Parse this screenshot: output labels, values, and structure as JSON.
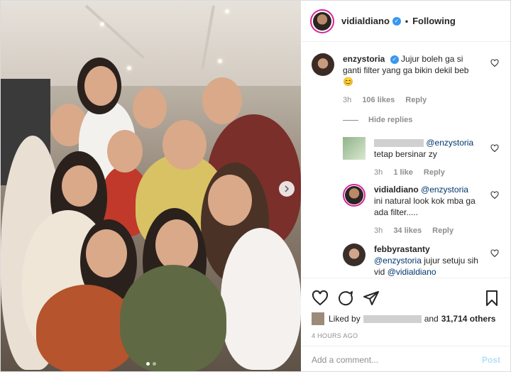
{
  "post": {
    "author": "vidialdiano",
    "follow_sep": "•",
    "follow_status": "Following"
  },
  "comments": [
    {
      "user": "enzystoria",
      "text": "Jujur boleh ga si ganti filter yang ga bikin dekil beb",
      "emoji": "😊",
      "time": "3h",
      "likes": "106 likes",
      "reply": "Reply"
    },
    {
      "mention": "@enzystoria",
      "text": "tetap bersinar zy",
      "time": "3h",
      "likes": "1 like",
      "reply": "Reply"
    },
    {
      "user": "vidialdiano",
      "mention": "@enzystoria",
      "text": "ini natural look kok mba ga ada filter.....",
      "time": "3h",
      "likes": "34 likes",
      "reply": "Reply"
    },
    {
      "user": "febbyrastanty",
      "mention": "@enzystoria",
      "text": "jujur setuju sih vid",
      "mention2": "@vidialdiano"
    }
  ],
  "hide_replies": "Hide replies",
  "liked_by_prefix": "Liked by",
  "liked_by_suffix": "and",
  "likes_count": "31,714 others",
  "timestamp": "4 HOURS AGO",
  "add_comment_placeholder": "Add a comment...",
  "post_button": "Post",
  "colors": {
    "verified": "#3897f0",
    "mention": "#00376b",
    "post_disabled": "#b2dffc"
  }
}
